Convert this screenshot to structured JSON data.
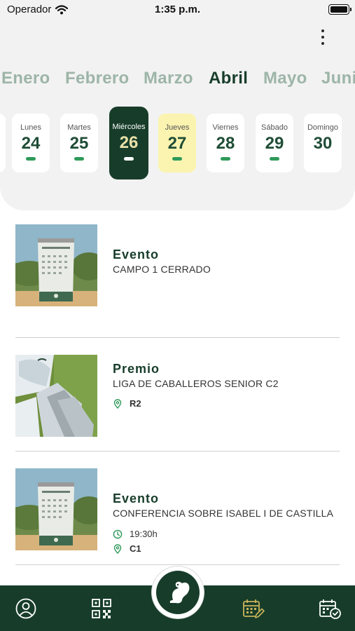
{
  "status_bar": {
    "carrier": "Operador",
    "time": "1:35 p.m."
  },
  "months": [
    "Enero",
    "Febrero",
    "Marzo",
    "Abril",
    "Mayo",
    "Juni"
  ],
  "active_month": "Abril",
  "days": [
    {
      "name": "Lunes",
      "num": "24",
      "has_event": true
    },
    {
      "name": "Martes",
      "num": "25",
      "has_event": true
    },
    {
      "name": "Miércoles",
      "num": "26",
      "has_event": true,
      "selected": true
    },
    {
      "name": "Jueves",
      "num": "27",
      "has_event": true,
      "today": true
    },
    {
      "name": "Viernes",
      "num": "28",
      "has_event": true
    },
    {
      "name": "Sábado",
      "num": "29",
      "has_event": true
    },
    {
      "name": "Domingo",
      "num": "30",
      "has_event": false
    }
  ],
  "events": [
    {
      "type": "Evento",
      "title": "CAMPO 1 CERRADO",
      "time": "",
      "location": "",
      "image": "desk-calendar"
    },
    {
      "type": "Premio",
      "title": "LIGA DE CABALLEROS SENIOR C2",
      "time": "",
      "location": "R2",
      "image": "golf-clubs"
    },
    {
      "type": "Evento",
      "title": "CONFERENCIA SOBRE ISABEL I DE CASTILLA",
      "time": "19:30h",
      "location": "C1",
      "image": "desk-calendar"
    }
  ],
  "tabbar": {
    "items": [
      "profile-icon",
      "qr-code-icon",
      "squirrel-logo",
      "calendar-edit-icon",
      "calendar-check-icon"
    ],
    "active": "calendar-edit-icon"
  },
  "colors": {
    "primary": "#173d2a",
    "accent": "#2e9a5a",
    "today": "#fbf4b0",
    "inactive_month": "#9db5a8",
    "active_tab": "#c9b35a"
  }
}
